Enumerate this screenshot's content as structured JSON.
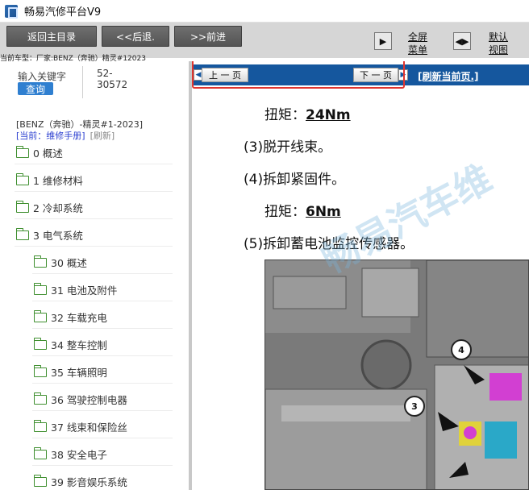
{
  "window": {
    "title": "畅易汽修平台V9"
  },
  "toolbar": {
    "home_label": "返回主目录",
    "back_label": "<<后退.",
    "forward_label": ">>前进",
    "fullscreen_line1": "全屏",
    "fullscreen_line2": "菜单",
    "default_view_line1": "默认",
    "default_view_line2": "视图",
    "current_vehicle": "当前车型：厂家:BENZ（奔驰）精灵#12023"
  },
  "search": {
    "placeholder": "输入关键字",
    "button_label": "查询",
    "code_line1": "52-",
    "code_line2": "30572"
  },
  "sidebar": {
    "vehicle_label": "[BENZ（奔驰）-精灵#1-2023]",
    "current_manual": "[当前：维修手册]",
    "refresh_label": "[刷新]",
    "items": [
      {
        "label": "0 概述",
        "level": 0
      },
      {
        "label": "1 维修材料",
        "level": 0
      },
      {
        "label": "2 冷却系统",
        "level": 0
      },
      {
        "label": "3 电气系统",
        "level": 0
      },
      {
        "label": "30 概述",
        "level": 1
      },
      {
        "label": "31 电池及附件",
        "level": 1
      },
      {
        "label": "32 车载充电",
        "level": 1
      },
      {
        "label": "34 整车控制",
        "level": 1
      },
      {
        "label": "35 车辆照明",
        "level": 1
      },
      {
        "label": "36 驾驶控制电器",
        "level": 1
      },
      {
        "label": "37 线束和保险丝",
        "level": 1
      },
      {
        "label": "38 安全电子",
        "level": 1
      },
      {
        "label": "39 影音娱乐系统",
        "level": 1
      }
    ]
  },
  "content": {
    "prev_page": "上 一 页",
    "next_page": "下 一 页",
    "refresh_page": "[刷新当前页.]",
    "watermark": "畅易汽车维",
    "lines": [
      {
        "label": "扭矩：",
        "value": "24Nm"
      },
      {
        "text": "(3)脱开线束。"
      },
      {
        "text": "(4)拆卸紧固件。"
      },
      {
        "label": "扭矩：",
        "value": "6Nm"
      },
      {
        "text": "(5)拆卸蓄电池监控传感器。"
      }
    ],
    "callouts": [
      "4",
      "3"
    ]
  }
}
